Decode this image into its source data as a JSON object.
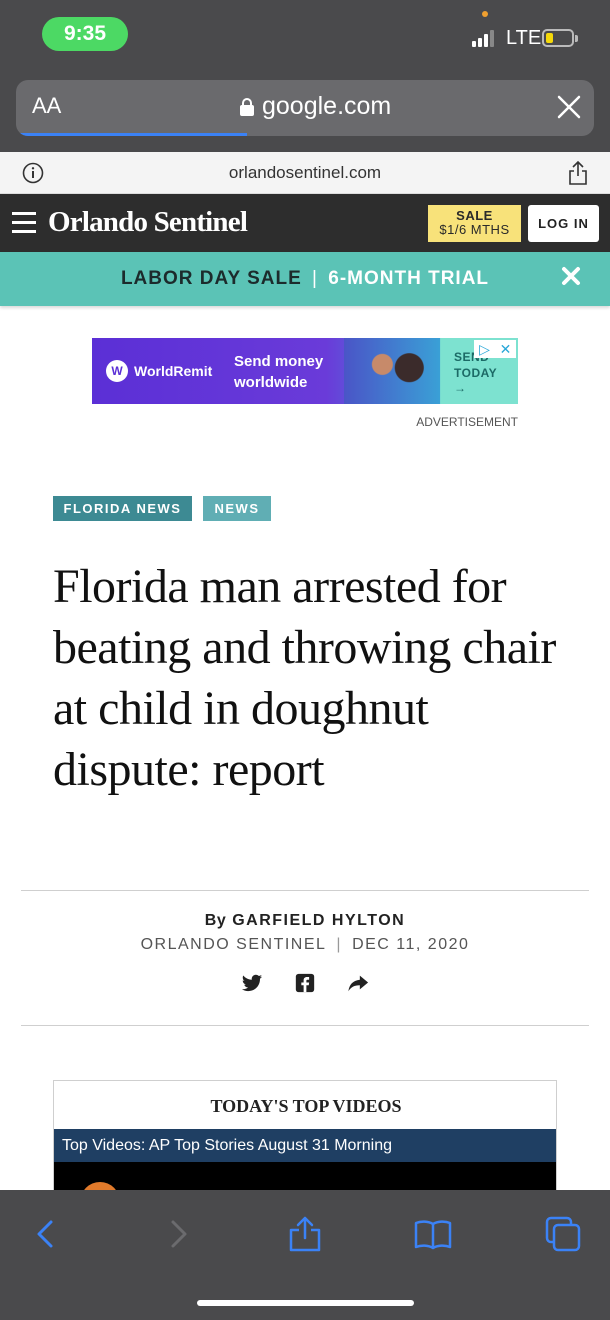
{
  "status_bar": {
    "time": "9:35",
    "network": "LTE",
    "time_pill_color": "#4cd964",
    "battery_color": "#f5d90a",
    "battery_level": 0.25
  },
  "browser": {
    "text_size_button": "AA",
    "address": "google.com",
    "close_icon": "close-icon",
    "load_progress": 0.4,
    "page_url": "orlandosentinel.com"
  },
  "site_header": {
    "logo": "Orlando Sentinel",
    "sale_line1": "SALE",
    "sale_line2": "$1/6 MTHS",
    "login_label": "LOG IN",
    "sale_color": "#f8e27a"
  },
  "promo": {
    "strong": "LABOR DAY SALE",
    "separator": "|",
    "light": "6-MONTH TRIAL",
    "bg_color": "#5bc3b6"
  },
  "ad": {
    "brand": "WorldRemit",
    "brand_glyph": "W",
    "tagline_line1": "Send money",
    "tagline_line2": "worldwide",
    "cta_line1": "SEND",
    "cta_line2": "TODAY",
    "cta_arrow": "→",
    "label": "ADVERTISEMENT"
  },
  "article": {
    "tags": [
      "FLORIDA NEWS",
      "NEWS"
    ],
    "headline": "Florida man arrested for beating and throwing chair at child in doughnut dispute: report",
    "byline_prefix": "By",
    "author": "GARFIELD HYLTON",
    "source": "ORLANDO SENTINEL",
    "meta_separator": "|",
    "date": "DEC 11, 2020",
    "social_icons": [
      "twitter-icon",
      "facebook-icon",
      "share-arrow-icon"
    ]
  },
  "videos": {
    "heading": "TODAY'S TOP VIDEOS",
    "current_title": "Top Videos: AP Top Stories August 31 Morning",
    "title_bar_color": "#1f3f63"
  },
  "toolbar": {
    "icons": [
      "back-icon",
      "forward-icon",
      "share-icon",
      "bookmarks-icon",
      "tabs-icon"
    ],
    "accent_color": "#3b82f6"
  }
}
